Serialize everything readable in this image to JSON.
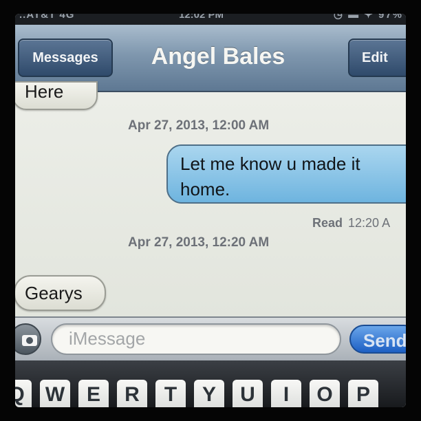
{
  "status_bar": {
    "left": "..AT&T 4G",
    "time": "12:02 PM",
    "right": "◷ ▬ ✦ 97%"
  },
  "nav": {
    "back_label": "Messages",
    "title": "Angel Bales",
    "edit_label": "Edit"
  },
  "messages": {
    "prev_fragment": "Here",
    "timestamp_1": "Apr 27, 2013, 12:00 AM",
    "outgoing_text": "Let me know u made it home.",
    "read_label": "Read",
    "read_time": "12:20 A",
    "timestamp_2": "Apr 27, 2013, 12:20 AM",
    "incoming_text": "Gearys"
  },
  "composer": {
    "placeholder": "iMessage",
    "send_label": "Send",
    "camera_icon": "camera-icon"
  },
  "keyboard": {
    "keys": [
      "Q",
      "W",
      "E",
      "R",
      "T",
      "Y",
      "U",
      "I",
      "O",
      "P"
    ]
  },
  "colors": {
    "nav_bar": "#7f97ae",
    "outgoing_bubble": "#8ac5e8",
    "send_button": "#1d5fc4"
  }
}
